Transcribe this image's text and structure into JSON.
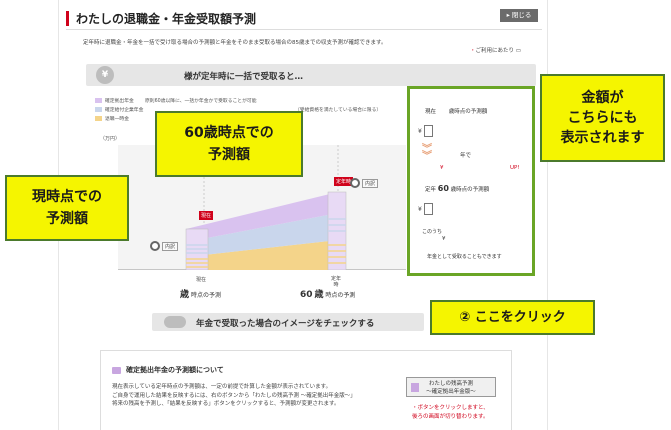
{
  "window": {
    "title": "わたしの退職金・年金受取額予測",
    "close_label": "閉じる"
  },
  "intro": {
    "text": "定年時に退職金・年金を一括で受け取る場合の予測額と年金をそのまま受取る場合の85歳までの収支予測が確認できます。",
    "note_link": "ご利用にあたり"
  },
  "section1": {
    "header": "様が定年時に一括で受取ると…",
    "legend": [
      {
        "name": "確定拠出年金",
        "desc": "原則60歳以降に、一括か年金かで受取ることが可能",
        "color": "#d9c2ef"
      },
      {
        "name": "確定給付企業年金",
        "desc": "（受給資格を満たしている場合に限る）",
        "color": "#c9d6ec"
      },
      {
        "name": "退職一時金",
        "desc": "",
        "color": "#f4d48a"
      }
    ],
    "unit": "（万円）",
    "now_marker": "現在",
    "now_caption": "現在",
    "now_age_unit": "歳",
    "now_age_suffix": "時点の予測",
    "ret_marker": "定年時",
    "ret_caption": "定年",
    "ret_caption2": "時",
    "ret_age_value": "60",
    "ret_age_unit": "歳",
    "ret_age_suffix": "時点の予測",
    "detail_label": "内訳",
    "detail_label2": "内訳"
  },
  "panel": {
    "row1_prefix": "現在",
    "row1_suffix": "歳時点の予測額",
    "yen": "¥",
    "mid_text": "年で",
    "mid_yen": "¥",
    "up": "UP!",
    "row2_prefix": "定年",
    "row2_age": "60",
    "row2_suffix": "歳時点の予測額",
    "yen2": "¥",
    "konouchi": "このうち",
    "yen3": "¥",
    "footer": "年金として受取ることもできます"
  },
  "callouts": {
    "amount": [
      "金額が",
      "こちらにも",
      "表示されます"
    ],
    "current": [
      "現時点での",
      "予測額"
    ],
    "age60": [
      "60歳時点での",
      "予測額"
    ],
    "click": "② ここをクリック"
  },
  "section2": {
    "header": "年金で受取った場合のイメージをチェックする"
  },
  "section3": {
    "title": "確定拠出年金の予測額について",
    "lines": [
      "現在表示している定年時点の予測額は、一定の前提で計算した金額が表示されています。",
      "ご自身で運用した結果を反映するには、右のボタンから「わたしの残高予測 〜確定拠出年金版〜」",
      "将来の残高を予測し、「結果を反映する」ボタンをクリックすると、予測額が変更されます。"
    ],
    "sim_button": [
      "わたしの残高予測",
      "〜確定拠出年金版〜"
    ],
    "sim_note": [
      "・ボタンをクリックしますと、",
      "後ろの画面が切り替わります。"
    ]
  },
  "chart_data": {
    "type": "area",
    "categories": [
      "現在",
      "定年時"
    ],
    "series": [
      {
        "name": "退職一時金",
        "color": "#f4d48a"
      },
      {
        "name": "確定給付企業年金",
        "color": "#c9d6ec"
      },
      {
        "name": "確定拠出年金",
        "color": "#d9c2ef"
      }
    ],
    "ylabel": "（万円）"
  }
}
